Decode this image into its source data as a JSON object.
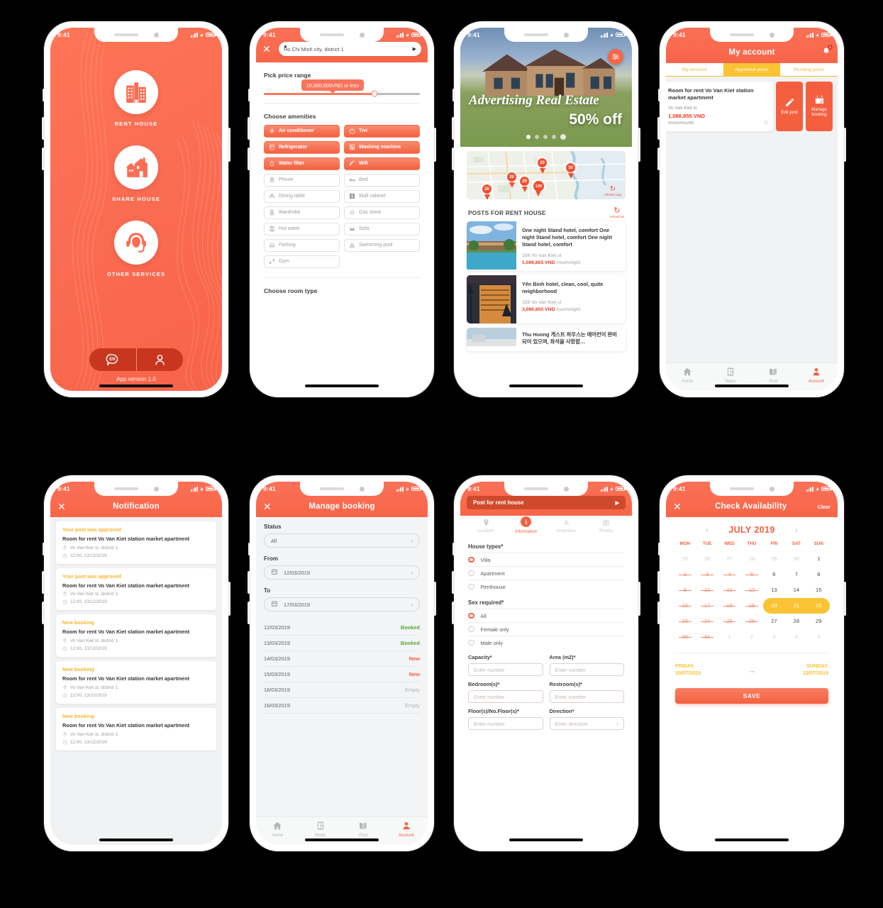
{
  "status_bar": {
    "time": "9:41"
  },
  "screen1": {
    "name": "splash-home",
    "items": [
      {
        "label": "RENT HOUSE",
        "icon": "building-icon"
      },
      {
        "label": "SHARE HOUSE",
        "icon": "house-icon"
      },
      {
        "label": "OTHER SERVICES",
        "icon": "support-agent-icon"
      }
    ],
    "lang_button": "EN",
    "version": "App version 1.0"
  },
  "screen2": {
    "name": "filter",
    "search_value": "Ho Chi Minh city, district 1",
    "price_heading": "Pick price range",
    "price_tooltip": "10,000,000VND or less",
    "amenities_heading": "Choose amenities",
    "amenities": [
      {
        "label": "Air conditioner",
        "icon": "snowflake-icon",
        "selected": true
      },
      {
        "label": "Tivi",
        "icon": "tv-icon",
        "selected": true
      },
      {
        "label": "Refrigerator",
        "icon": "fridge-icon",
        "selected": true
      },
      {
        "label": "Washing machine",
        "icon": "washer-icon",
        "selected": true
      },
      {
        "label": "Water filter",
        "icon": "water-drop-icon",
        "selected": true
      },
      {
        "label": "Wifi",
        "icon": "wifi-icon",
        "selected": true
      },
      {
        "label": "Phone",
        "icon": "telephone-icon",
        "selected": false
      },
      {
        "label": "Bed",
        "icon": "bed-icon",
        "selected": false
      },
      {
        "label": "Dining table",
        "icon": "dining-table-icon",
        "selected": false
      },
      {
        "label": "Wall cabinet",
        "icon": "cabinet-icon",
        "selected": false
      },
      {
        "label": "Wardrobe",
        "icon": "wardrobe-icon",
        "selected": false
      },
      {
        "label": "Gas stove",
        "icon": "gas-stove-icon",
        "selected": false
      },
      {
        "label": "Hot water",
        "icon": "water-heater-icon",
        "selected": false
      },
      {
        "label": "Sofa",
        "icon": "sofa-icon",
        "selected": false
      },
      {
        "label": "Parking",
        "icon": "car-icon",
        "selected": false
      },
      {
        "label": "Swimming pool",
        "icon": "pool-icon",
        "selected": false
      },
      {
        "label": "Gym",
        "icon": "dumbbell-icon",
        "selected": false
      }
    ],
    "roomtype_heading": "Choose room type"
  },
  "screen3": {
    "name": "home-listings",
    "hero_title": "Advertising Real Estate",
    "hero_sub": "50% off",
    "map_pins": [
      "20",
      "20",
      "20",
      "20",
      "100",
      "30"
    ],
    "refresh_map_label": "refresh map",
    "posts_heading": "POSTS FOR RENT HOUSE",
    "refresh_list_label": "refresh list",
    "posts": [
      {
        "title": "One night Stand hotel, comfort One night Stand hotel, comfort One night Stand hotel, comfort",
        "address": "158 Vo Van Kiet st",
        "price": "1,086,855 VND",
        "unit": "/room/night"
      },
      {
        "title": "Yên Binh hotel, clean, cool, quite neighborhood",
        "address": "158 Vo Van Kiet st",
        "price": "3,086,855 VND",
        "unit": "/room/night"
      },
      {
        "title": "Thu Huong 게스트 하우스는 에어컨이 완비되어 있으며, 좌석을 사랑합…",
        "address": "",
        "price": "",
        "unit": ""
      }
    ]
  },
  "screen4": {
    "name": "my-account",
    "title": "My account",
    "notification_badge": "1",
    "tabs": [
      {
        "label": "My account",
        "active": false
      },
      {
        "label": "Approved posts",
        "active": true
      },
      {
        "label": "Pending posts",
        "active": false
      }
    ],
    "post": {
      "title": "Room for rent Vo Van Kiet station market apartment",
      "address": "Vo Van Kiet st",
      "price": "1,086,855 VND",
      "unit": "/room/month"
    },
    "actions": [
      {
        "label": "Edit post",
        "icon": "pencil-icon"
      },
      {
        "label": "Manage booking",
        "icon": "calendar-check-icon"
      }
    ],
    "tabbar": [
      {
        "label": "Home",
        "icon": "home-icon",
        "active": false
      },
      {
        "label": "News",
        "icon": "news-icon",
        "active": false
      },
      {
        "label": "Post",
        "icon": "post-icon",
        "active": false
      },
      {
        "label": "Account",
        "icon": "person-icon",
        "active": true
      }
    ]
  },
  "screen5": {
    "name": "notification",
    "title": "Notification",
    "notifications": [
      {
        "kind": "Your post was approved",
        "title": "Room for rent Vo Van Kiet station market apartment",
        "place": "Vo Van Kiet st, district 1",
        "time": "12:00, 13/12/2019"
      },
      {
        "kind": "Your post was approved",
        "title": "Room for rent Vo Van Kiet station market apartment",
        "place": "Vo Van Kiet st, district 1",
        "time": "12:00, 13/12/2019"
      },
      {
        "kind": "New booking",
        "title": "Room for rent Vo Van Kiet station market apartment",
        "place": "Vo Van Kiet st, district 1",
        "time": "12:00, 13/12/2019"
      },
      {
        "kind": "New booking",
        "title": "Room for rent Vo Van Kiet station market apartment",
        "place": "Vo Van Kiet st, district 1",
        "time": "12:00, 13/12/2019"
      },
      {
        "kind": "New booking",
        "title": "Room for rent Vo Van Kiet station market apartment",
        "place": "Vo Van Kiet st, district 1",
        "time": "12:00, 13/12/2019"
      }
    ]
  },
  "screen6": {
    "name": "manage-booking",
    "title": "Manage booking",
    "status_label": "Status",
    "status_value": "All",
    "from_label": "From",
    "from_value": "12/03/2019",
    "to_label": "To",
    "to_value": "17/03/2019",
    "rows": [
      {
        "date": "12/03/2019",
        "status": "Booked",
        "state": "booked"
      },
      {
        "date": "13/03/2019",
        "status": "Booked",
        "state": "booked"
      },
      {
        "date": "14/03/2019",
        "status": "New",
        "state": "new"
      },
      {
        "date": "15/03/2019",
        "status": "New",
        "state": "new"
      },
      {
        "date": "16/03/2019",
        "status": "Empty",
        "state": "empty"
      },
      {
        "date": "16/03/2019",
        "status": "Empty",
        "state": "empty"
      }
    ],
    "tabbar": [
      {
        "label": "Home",
        "icon": "home-icon",
        "active": false
      },
      {
        "label": "News",
        "icon": "news-icon",
        "active": false
      },
      {
        "label": "Post",
        "icon": "post-icon",
        "active": false
      },
      {
        "label": "Account",
        "icon": "person-icon",
        "active": true
      }
    ]
  },
  "screen7": {
    "name": "post-for-rent-house",
    "header_pill": "Post for rent house",
    "steps": [
      {
        "label": "Location",
        "icon": "map-pin-icon",
        "active": false
      },
      {
        "label": "Information",
        "icon": "info-icon",
        "active": true
      },
      {
        "label": "Amenities",
        "icon": "amenities-icon",
        "active": false
      },
      {
        "label": "Photos",
        "icon": "camera-icon",
        "active": false
      }
    ],
    "house_types_label": "House types*",
    "house_types": [
      {
        "label": "Villa",
        "selected": true
      },
      {
        "label": "Apartment",
        "selected": false
      },
      {
        "label": "Penthouse",
        "selected": false
      }
    ],
    "sex_label": "Sex required*",
    "sex_options": [
      {
        "label": "All",
        "selected": true
      },
      {
        "label": "Female only",
        "selected": false
      },
      {
        "label": "Male only",
        "selected": false
      }
    ],
    "fields": [
      {
        "label": "Capacity*",
        "placeholder": "Enter number",
        "chevron": false
      },
      {
        "label": "Area (m2)*",
        "placeholder": "Enter number",
        "chevron": false
      },
      {
        "label": "Bedroom(s)*",
        "placeholder": "Enter number",
        "chevron": false
      },
      {
        "label": "Restroom(s)*",
        "placeholder": "Enter number",
        "chevron": false
      },
      {
        "label": "Floor(s)/No.Floor(s)*",
        "placeholder": "Enter number",
        "chevron": false
      },
      {
        "label": "Direction*",
        "placeholder": "Enter direction",
        "chevron": true
      }
    ]
  },
  "screen8": {
    "name": "check-availability",
    "title": "Check Availability",
    "clear_label": "Clear",
    "month": "JULY 2019",
    "weekdays": [
      "MON",
      "TUE",
      "WED",
      "THU",
      "FRI",
      "SAT",
      "SUN"
    ],
    "weeks": [
      [
        {
          "d": "25",
          "s": "mute"
        },
        {
          "d": "26",
          "s": "mute"
        },
        {
          "d": "27",
          "s": "mute"
        },
        {
          "d": "28",
          "s": "mute"
        },
        {
          "d": "29",
          "s": "mute"
        },
        {
          "d": "30",
          "s": "mute"
        },
        {
          "d": "1",
          "s": ""
        }
      ],
      [
        {
          "d": "2",
          "s": "cross"
        },
        {
          "d": "3",
          "s": "cross"
        },
        {
          "d": "4",
          "s": "cross"
        },
        {
          "d": "5",
          "s": "cross"
        },
        {
          "d": "6",
          "s": ""
        },
        {
          "d": "7",
          "s": ""
        },
        {
          "d": "8",
          "s": ""
        }
      ],
      [
        {
          "d": "9",
          "s": "cross"
        },
        {
          "d": "10",
          "s": "cross"
        },
        {
          "d": "11",
          "s": "cross"
        },
        {
          "d": "12",
          "s": "cross"
        },
        {
          "d": "13",
          "s": ""
        },
        {
          "d": "14",
          "s": ""
        },
        {
          "d": "15",
          "s": ""
        }
      ],
      [
        {
          "d": "16",
          "s": "cross"
        },
        {
          "d": "17",
          "s": "cross"
        },
        {
          "d": "18",
          "s": "cross"
        },
        {
          "d": "19",
          "s": "cross"
        },
        {
          "d": "20",
          "s": "sel first"
        },
        {
          "d": "21",
          "s": "sel"
        },
        {
          "d": "22",
          "s": "sel last"
        }
      ],
      [
        {
          "d": "23",
          "s": "cross"
        },
        {
          "d": "24",
          "s": "cross"
        },
        {
          "d": "25",
          "s": "cross"
        },
        {
          "d": "26",
          "s": "cross"
        },
        {
          "d": "27",
          "s": ""
        },
        {
          "d": "28",
          "s": ""
        },
        {
          "d": "29",
          "s": ""
        }
      ],
      [
        {
          "d": "30",
          "s": "cross"
        },
        {
          "d": "31",
          "s": "cross"
        },
        {
          "d": "1",
          "s": "mute"
        },
        {
          "d": "2",
          "s": "mute"
        },
        {
          "d": "3",
          "s": "mute"
        },
        {
          "d": "4",
          "s": "mute"
        },
        {
          "d": "5",
          "s": "mute"
        }
      ]
    ],
    "range_start": "FRIDAY,\n20/07/2019",
    "range_end": "SUNDAY,\n22/07/2019",
    "save_label": "SAVE"
  },
  "colors": {
    "brand": "#f4603f",
    "brand_light": "#fb7157",
    "yellow": "#f9c333",
    "green": "#56a83b",
    "red_price": "#e53b20"
  }
}
